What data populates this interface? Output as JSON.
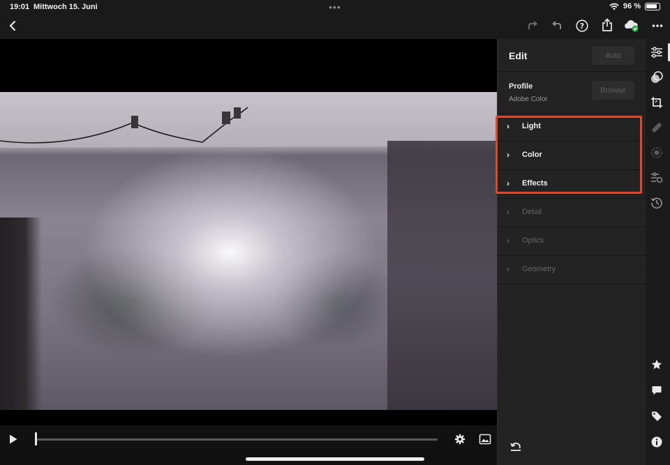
{
  "status_bar": {
    "time": "19:01",
    "date": "Mittwoch 15. Juni",
    "dots": "•••",
    "battery_percent": "96 %"
  },
  "toolbar": {
    "icons": [
      "back-icon",
      "redo-icon",
      "undo-icon",
      "help-icon",
      "share-icon",
      "cloud-sync-icon",
      "more-icon"
    ]
  },
  "edit_panel": {
    "title": "Edit",
    "auto_label": "Auto",
    "profile_label": "Profile",
    "profile_value": "Adobe Color",
    "browse_label": "Browse",
    "sections": [
      {
        "label": "Light",
        "enabled": true
      },
      {
        "label": "Color",
        "enabled": true
      },
      {
        "label": "Effects",
        "enabled": true
      },
      {
        "label": "Detail",
        "enabled": false
      },
      {
        "label": "Optics",
        "enabled": false
      },
      {
        "label": "Geometry",
        "enabled": false
      }
    ],
    "highlight_color": "#e2462b"
  },
  "tool_rail": {
    "icons": [
      "adjust-sliders-icon",
      "masking-icon",
      "crop-icon",
      "healing-icon",
      "selective-icon",
      "presets-icon",
      "history-icon",
      "star-icon",
      "comment-icon",
      "tag-icon",
      "info-icon"
    ]
  },
  "playback": {
    "progress": 0.0
  }
}
